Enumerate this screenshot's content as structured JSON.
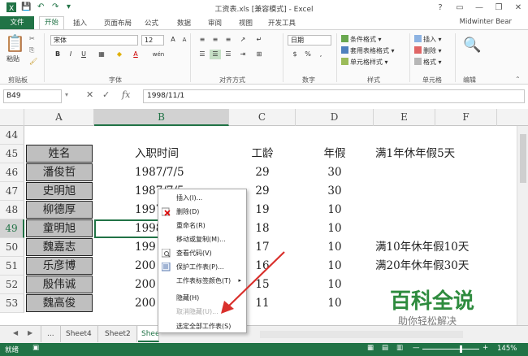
{
  "window": {
    "title": "工资表.xls [兼容模式] - Excel",
    "controls": [
      "?",
      "▭",
      "—",
      "❐",
      "✕"
    ]
  },
  "ribbon_tabs": [
    "文件",
    "开始",
    "插入",
    "页面布局",
    "公式",
    "数据",
    "审阅",
    "视图",
    "开发工具"
  ],
  "user": "Midwinter Bear",
  "ribbon": {
    "clipboard": {
      "paste": "粘贴",
      "label": "剪贴板"
    },
    "font": {
      "name": "宋体",
      "size": "12",
      "bold": "B",
      "italic": "I",
      "underline": "U",
      "grow": "A",
      "shrink": "A",
      "font_color": "A",
      "wen": "wén",
      "label": "字体"
    },
    "alignment": {
      "label": "对齐方式"
    },
    "number": {
      "format": "日期",
      "label": "数字"
    },
    "styles": {
      "cond": "条件格式",
      "table": "套用表格格式",
      "cell": "单元格样式",
      "label": "样式"
    },
    "cells": {
      "insert": "插入",
      "delete": "删除",
      "format": "格式",
      "label": "单元格"
    },
    "editing": {
      "label": "编辑"
    }
  },
  "formula_bar": {
    "name_box": "B49",
    "fx": "fx",
    "value": "1998/11/1"
  },
  "columns": [
    "A",
    "B",
    "C",
    "D",
    "E",
    "F"
  ],
  "rows": [
    {
      "num": "44",
      "a": "",
      "b": "",
      "c": "",
      "d": "",
      "e": ""
    },
    {
      "num": "45",
      "a": "姓名",
      "b": "入职时间",
      "c": "工龄",
      "d": "年假",
      "e": "满1年休年假5天"
    },
    {
      "num": "46",
      "a": "潘俊哲",
      "b": "1987/7/5",
      "c": "29",
      "d": "30",
      "e": ""
    },
    {
      "num": "47",
      "a": "史明旭",
      "b": "1987/7/5",
      "c": "29",
      "d": "30",
      "e": ""
    },
    {
      "num": "48",
      "a": "柳德厚",
      "b": "1997",
      "c": "19",
      "d": "10",
      "e": ""
    },
    {
      "num": "49",
      "a": "童明旭",
      "b": "1998",
      "c": "18",
      "d": "10",
      "e": ""
    },
    {
      "num": "50",
      "a": "魏嘉志",
      "b": "199",
      "c": "17",
      "d": "10",
      "e": "满10年休年假10天"
    },
    {
      "num": "51",
      "a": "乐彦博",
      "b": "200",
      "c": "16",
      "d": "10",
      "e": "满20年休年假30天"
    },
    {
      "num": "52",
      "a": "殷伟诚",
      "b": "200",
      "c": "15",
      "d": "10",
      "e": ""
    },
    {
      "num": "53",
      "a": "魏高俊",
      "b": "200",
      "c": "11",
      "d": "10",
      "e": ""
    }
  ],
  "context_menu": [
    {
      "label": "插入(I)...",
      "enabled": true
    },
    {
      "label": "删除(D)",
      "enabled": true
    },
    {
      "label": "重命名(R)",
      "enabled": true
    },
    {
      "label": "移动或复制(M)...",
      "enabled": true
    },
    {
      "label": "查看代码(V)",
      "enabled": true
    },
    {
      "label": "保护工作表(P)...",
      "enabled": true
    },
    {
      "label": "工作表标签颜色(T)",
      "enabled": true,
      "submenu": "▸"
    },
    {
      "label": "隐藏(H)",
      "enabled": true
    },
    {
      "label": "取消隐藏(U)...",
      "enabled": false
    },
    {
      "label": "选定全部工作表(S)",
      "enabled": true
    }
  ],
  "sheet_tabs": {
    "ellipsis": "...",
    "tabs": [
      "Sheet4",
      "Sheet2",
      "Shee"
    ],
    "active": "Shee"
  },
  "status": {
    "ready": "就绪",
    "zoom": "145%"
  },
  "watermark": {
    "title": "百科全说",
    "subtitle": "助你轻松解决"
  },
  "colors": {
    "excel_green": "#217346",
    "name_cell_gray": "#bfbfbf",
    "arrow_red": "#d9302c",
    "watermark_green": "#2e8b3e"
  }
}
